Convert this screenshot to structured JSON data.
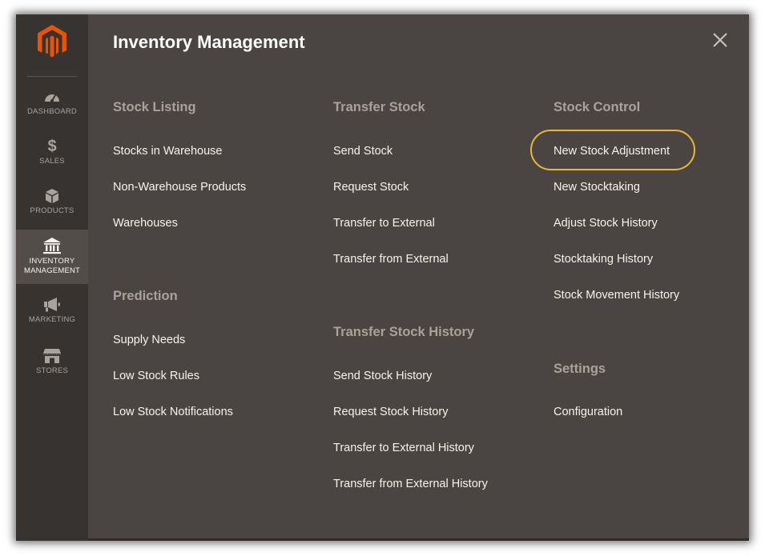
{
  "sidebar": {
    "logo_icon": "magento-logo-icon",
    "items": [
      {
        "label": "DASHBOARD",
        "icon": "speedometer-icon"
      },
      {
        "label": "SALES",
        "icon": "dollar-icon",
        "glyph": "$"
      },
      {
        "label": "PRODUCTS",
        "icon": "cube-icon"
      },
      {
        "label_line1": "INVENTORY",
        "label_line2": "MANAGEMENT",
        "icon": "bank-icon",
        "active": true
      },
      {
        "label": "MARKETING",
        "icon": "megaphone-icon"
      },
      {
        "label": "STORES",
        "icon": "storefront-icon"
      }
    ]
  },
  "panel": {
    "title": "Inventory Management",
    "close_icon": "close-icon",
    "columns": [
      {
        "sections": [
          {
            "title": "Stock Listing",
            "links": [
              "Stocks in Warehouse",
              "Non-Warehouse Products",
              "Warehouses"
            ]
          },
          {
            "title": "Prediction",
            "links": [
              "Supply Needs",
              "Low Stock Rules",
              "Low Stock Notifications"
            ]
          }
        ]
      },
      {
        "sections": [
          {
            "title": "Transfer Stock",
            "links": [
              "Send Stock",
              "Request Stock",
              "Transfer to External",
              "Transfer from External"
            ]
          },
          {
            "title": "Transfer Stock History",
            "links": [
              "Send Stock History",
              "Request Stock History",
              "Transfer to External History",
              "Transfer from External History"
            ]
          }
        ]
      },
      {
        "sections": [
          {
            "title": "Stock Control",
            "links": [
              "New Stock Adjustment",
              "New Stocktaking",
              "Adjust Stock History",
              "Stocktaking History",
              "Stock Movement History"
            ]
          },
          {
            "title": "Settings",
            "links": [
              "Configuration"
            ]
          }
        ]
      }
    ]
  },
  "colors": {
    "sidebar_bg": "#373330",
    "panel_bg": "#4a4542",
    "active_bg": "#524d49",
    "logo_orange": "#eb5202",
    "highlight_ring": "#eab82e",
    "section_title": "#a8a29b",
    "link_text": "#f7f3eb"
  }
}
